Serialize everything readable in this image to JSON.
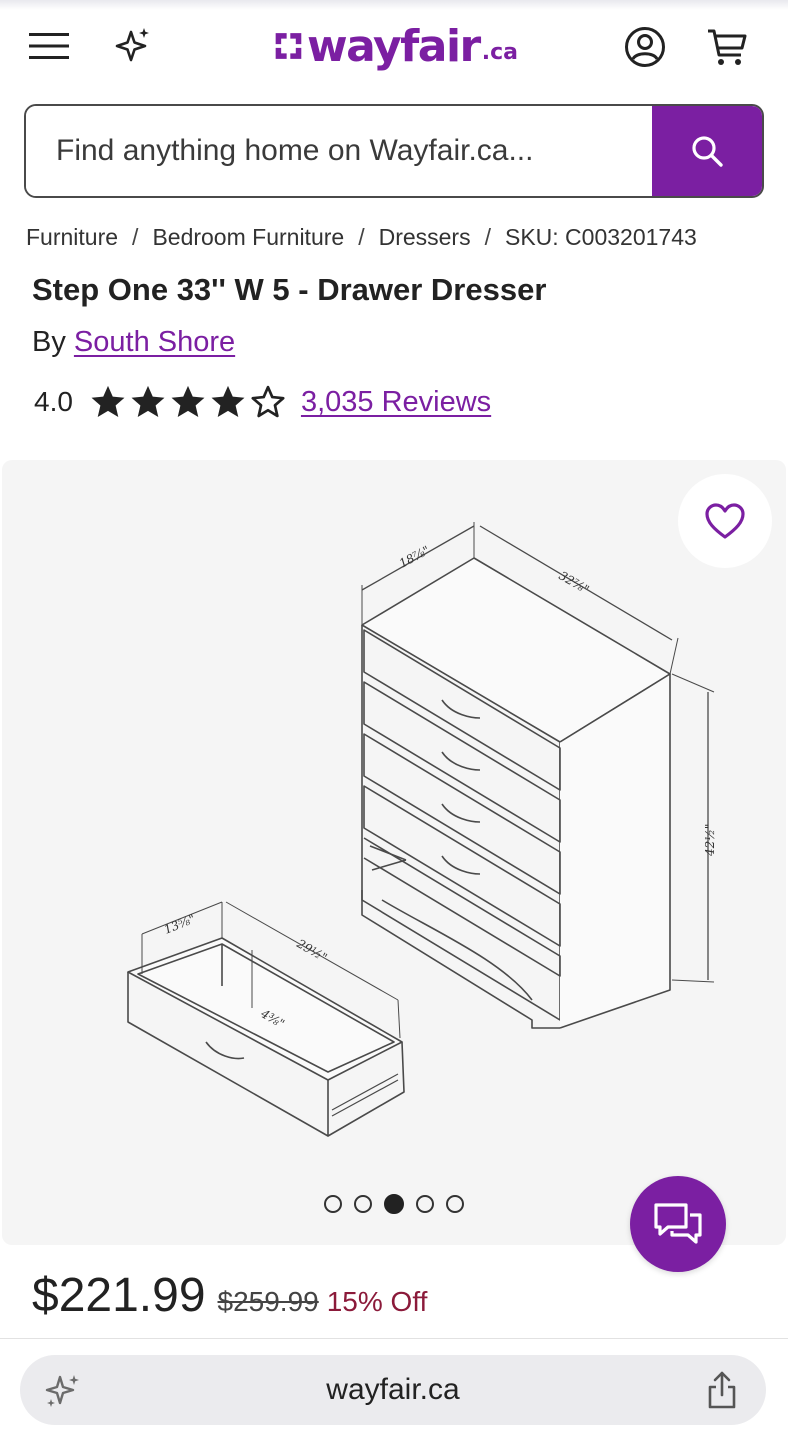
{
  "header": {
    "logo_word": "wayfair",
    "logo_tld": ".ca",
    "brand_color": "#7b1fa2",
    "icons": [
      "hamburger-menu-icon",
      "sparkle-icon",
      "account-icon",
      "cart-icon"
    ]
  },
  "search": {
    "placeholder": "Find anything home on Wayfair.ca..."
  },
  "breadcrumb": {
    "items": [
      "Furniture",
      "Bedroom Furniture",
      "Dressers"
    ],
    "separator": "/",
    "sku": "SKU: C003201743"
  },
  "product": {
    "title": "Step One 33'' W 5 - Drawer Dresser",
    "by_label": "By",
    "brand": "South Shore",
    "rating_value": "4.0",
    "rating_stars": 4,
    "rating_max": 5,
    "reviews_label": "3,035 Reviews"
  },
  "gallery": {
    "dimensions": {
      "depth": "18⅞\"",
      "width": "32⅞\"",
      "height": "42½\"",
      "drawer_depth": "13⅝\"",
      "drawer_width": "29½\"",
      "drawer_height": "4⅜\""
    },
    "image_count": 5,
    "active_index": 2
  },
  "pricing": {
    "price": "$221.99",
    "old_price": "$259.99",
    "discount": "15% Off",
    "discount_color": "#8b1a3a"
  },
  "browser": {
    "url": "wayfair.ca"
  }
}
